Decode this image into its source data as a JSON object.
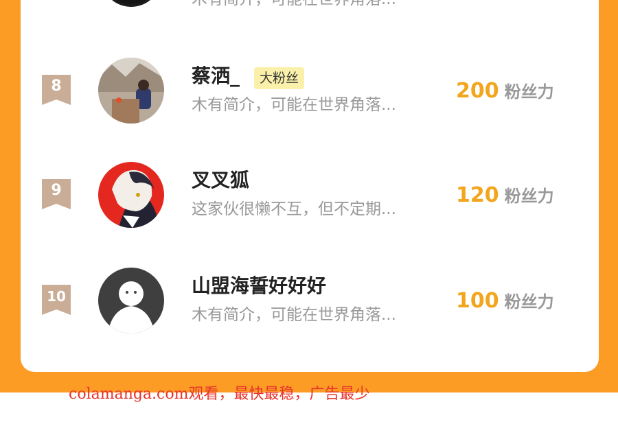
{
  "top_row": {
    "bio": "木有简介，可能在世界角落..."
  },
  "rows": [
    {
      "rank": "8",
      "name": "蔡洒_",
      "badge": "大粉丝",
      "bio": "木有简介，可能在世界角落...",
      "score": "200",
      "unit": "粉丝力",
      "avatar": "photo-avatar"
    },
    {
      "rank": "9",
      "name": "叉叉狐",
      "badge": "",
      "bio": "这家伙很懒不互，但不定期...",
      "score": "120",
      "unit": "粉丝力",
      "avatar": "anime-avatar"
    },
    {
      "rank": "10",
      "name": "山盟海誓好好好",
      "badge": "",
      "bio": "木有简介，可能在世界角落...",
      "score": "100",
      "unit": "粉丝力",
      "avatar": "default-avatar"
    }
  ],
  "watermark": "colamanga.com观看，最快最稳，广告最少",
  "colors": {
    "page_bg": "#fc9c25",
    "card_bg": "#ffffff",
    "score": "#f2a51d",
    "badge_bg": "#fbf0a9",
    "rank_badge": "#c9ad97",
    "watermark": "#e8342a"
  }
}
